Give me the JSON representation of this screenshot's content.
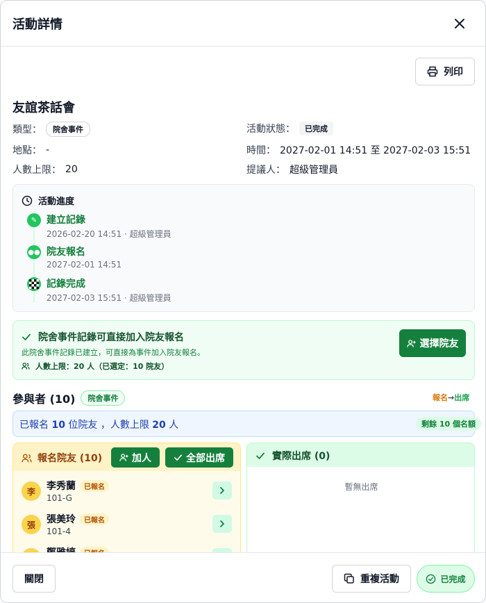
{
  "header": {
    "title": "活動詳情",
    "close_icon": "close-icon"
  },
  "toolbar": {
    "print_label": "列印"
  },
  "event": {
    "title": "友誼茶話會",
    "type_label": "類型：",
    "type_value": "院舍事件",
    "status_label": "活動狀態：",
    "status_value": "已完成",
    "location_label": "地點：",
    "location_value": "-",
    "time_label": "時間：",
    "time_value": "2027-02-01 14:51 至 2027-02-03 15:51",
    "capacity_label": "人數上限：",
    "capacity_value": "20",
    "proposer_label": "提議人：",
    "proposer_value": "超級管理員"
  },
  "progress": {
    "title": "活動進度",
    "steps": [
      {
        "label": "建立記錄",
        "meta": "2026-02-20 14:51 · 超級管理員",
        "icon": "memo-icon"
      },
      {
        "label": "院友報名",
        "meta": "2027-02-01 14:51",
        "icon": "people-icon"
      },
      {
        "label": "記錄完成",
        "meta": "2027-02-03 15:51 · 超級管理員",
        "icon": "checkered-flag-icon"
      }
    ]
  },
  "notice": {
    "title": "院舍事件記錄可直接加入院友報名",
    "desc": "此院舍事件記錄已建立，可直接為事件加入院友報名。",
    "capacity": "人數上限：20 人（已選定：10 院友）",
    "button": "選擇院友"
  },
  "participants": {
    "title": "參與者 (10)",
    "badge": "院舍事件",
    "flow_from": "報名",
    "flow_arrow": "→",
    "flow_to": "出席",
    "summary_prefix": "已報名 ",
    "summary_count": "10",
    "summary_mid": " 位院友 ，人數上限 ",
    "summary_limit": "20",
    "summary_suffix": " 人",
    "remaining": "剩餘 10 個名額"
  },
  "registered": {
    "title": "報名院友 (10)",
    "add_label": "加人",
    "all_label": "全部出席",
    "items": [
      {
        "avatar": "李",
        "name": "李秀蘭",
        "room": "101-G",
        "tag": "已報名"
      },
      {
        "avatar": "張",
        "name": "張美玲",
        "room": "101-4",
        "tag": "已報名"
      },
      {
        "avatar": "鄭",
        "name": "鄭雅婷",
        "room": "",
        "tag": "已報名"
      }
    ]
  },
  "attended": {
    "title": "實際出席 (0)",
    "empty": "暫無出席"
  },
  "footer": {
    "close_label": "關閉",
    "duplicate_label": "重複活動",
    "done_label": "已完成"
  },
  "colors": {
    "accent_green": "#15803d",
    "amber": "#f59e0b",
    "blue_text": "#1e40af"
  }
}
